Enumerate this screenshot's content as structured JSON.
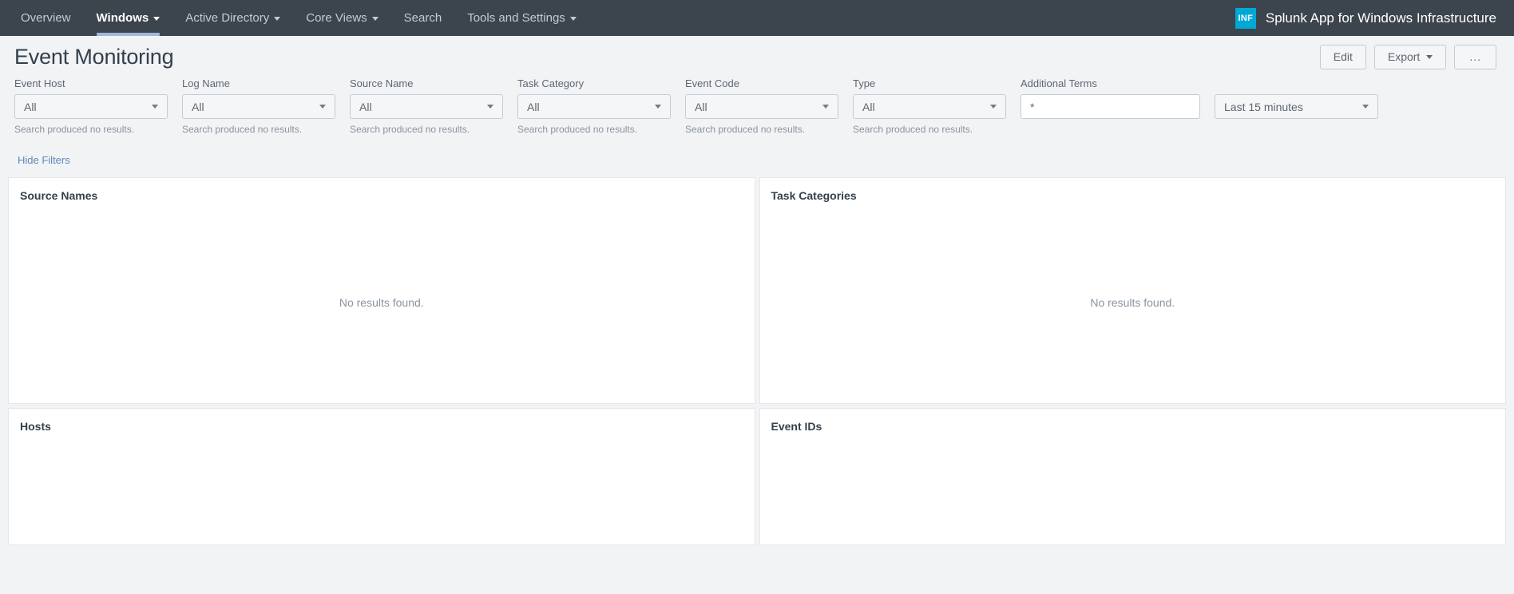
{
  "navbar": {
    "items": [
      {
        "label": "Overview",
        "has_caret": false,
        "active": false
      },
      {
        "label": "Windows",
        "has_caret": true,
        "active": true
      },
      {
        "label": "Active Directory",
        "has_caret": true,
        "active": false
      },
      {
        "label": "Core Views",
        "has_caret": true,
        "active": false
      },
      {
        "label": "Search",
        "has_caret": false,
        "active": false
      },
      {
        "label": "Tools and Settings",
        "has_caret": true,
        "active": false
      }
    ],
    "app_badge": "INF",
    "app_title": "Splunk App for Windows Infrastructure",
    "background_color": "#3c444d",
    "badge_color": "#00a8d6",
    "active_underline_color": "#9fb7d9"
  },
  "header": {
    "page_title": "Event Monitoring",
    "buttons": [
      {
        "label": "Edit",
        "has_caret": false
      },
      {
        "label": "Export",
        "has_caret": true
      },
      {
        "label": "...",
        "has_caret": false
      }
    ]
  },
  "filters": {
    "hint_text": "Search produced no results.",
    "fields": [
      {
        "label": "Event Host",
        "value": "All",
        "hint": "Search produced no results."
      },
      {
        "label": "Log Name",
        "value": "All",
        "hint": "Search produced no results."
      },
      {
        "label": "Source Name",
        "value": "All",
        "hint": "Search produced no results."
      },
      {
        "label": "Task Category",
        "value": "All",
        "hint": "Search produced no results."
      },
      {
        "label": "Event Code",
        "value": "All",
        "hint": "Search produced no results."
      },
      {
        "label": "Type",
        "value": "All",
        "hint": "Search produced no results."
      }
    ],
    "additional_terms": {
      "label": "Additional Terms",
      "value": "*",
      "placeholder": "*"
    },
    "time_range": {
      "value": "Last 15 minutes"
    },
    "hide_filters_label": "Hide Filters",
    "link_color": "#5b88b8"
  },
  "panels": [
    {
      "title": "Source Names",
      "message": "No results found."
    },
    {
      "title": "Task Categories",
      "message": "No results found."
    },
    {
      "title": "Hosts",
      "message": ""
    },
    {
      "title": "Event IDs",
      "message": ""
    }
  ]
}
